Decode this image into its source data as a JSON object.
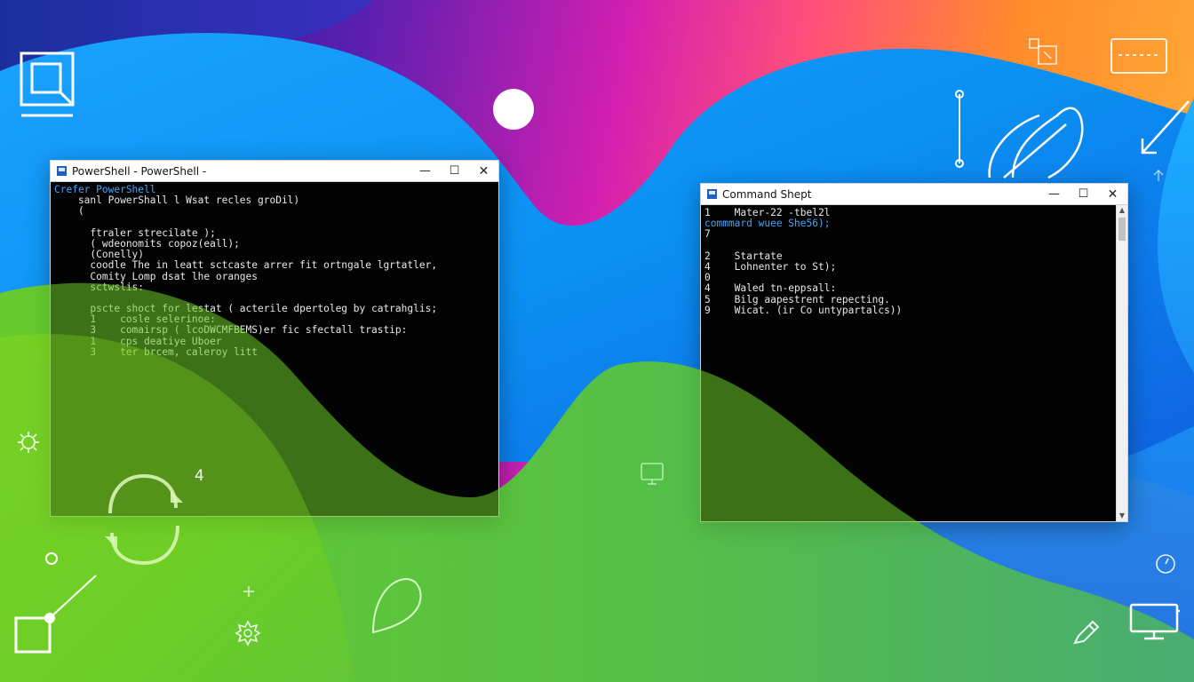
{
  "windows": {
    "powershell": {
      "title": "PowerShell - PowerShell -",
      "minimize_glyph": "—",
      "maximize_glyph": "☐",
      "close_glyph": "✕",
      "lines": [
        {
          "text": "Crefer PowerShell",
          "style": "blue"
        },
        {
          "text": "    sanl PowerShall l Wsat recles groDil)",
          "style": "normal"
        },
        {
          "text": "    (",
          "style": "normal"
        },
        {
          "text": "",
          "style": "normal"
        },
        {
          "text": "      ftraler strecilate );",
          "style": "normal"
        },
        {
          "text": "      ( wdeonomits copoz(eall);",
          "style": "normal"
        },
        {
          "text": "      (Conelly)",
          "style": "normal"
        },
        {
          "text": "      coodle The in leatt sctcaste arrer fit ortngale lgrtatler,",
          "style": "normal"
        },
        {
          "text": "      Comity Lomp dsat lhe oranges",
          "style": "normal"
        },
        {
          "text": "      sctwslis:",
          "style": "normal"
        },
        {
          "text": "",
          "style": "normal"
        },
        {
          "text": "      pscte shoct for lestat ( acterile dpertoleg by catrahglis;",
          "style": "normal"
        },
        {
          "text": "      1    cosle selerinoe:",
          "style": "normal"
        },
        {
          "text": "      3    comairsp ( lcoDWCMFBEMS)er fic sfectall trastip:",
          "style": "normal"
        },
        {
          "text": "      1    cps deatiye Uboer",
          "style": "normal"
        },
        {
          "text": "      3    ter brcem, caleroy litt",
          "style": "normal"
        }
      ]
    },
    "command": {
      "title": "Command Shept",
      "minimize_glyph": "—",
      "maximize_glyph": "☐",
      "close_glyph": "✕",
      "lines": [
        {
          "text": "1    Mater-22 -tbel2l",
          "style": "normal"
        },
        {
          "text": "commmard wuee She56);",
          "style": "blue"
        },
        {
          "text": "7",
          "style": "normal"
        },
        {
          "text": "",
          "style": "normal"
        },
        {
          "text": "2    Startate",
          "style": "normal"
        },
        {
          "text": "4    Lohnenter to St);",
          "style": "normal"
        },
        {
          "text": "0",
          "style": "normal"
        },
        {
          "text": "4    Waled tn-eppsall:",
          "style": "normal"
        },
        {
          "text": "5    Bilg aapestrent repecting.",
          "style": "normal"
        },
        {
          "text": "9    Wicat. (ir Co untypartalcs))",
          "style": "normal"
        }
      ]
    }
  },
  "decor": {
    "badge_number": "4"
  },
  "colors": {
    "accent_blue": "#3fa6ff",
    "terminal_bg": "#030303",
    "terminal_fg": "#e8e8e8",
    "titlebar_bg": "#ffffff"
  },
  "icons": {
    "top_left": "frame-icon",
    "top_right_a": "grid-icon",
    "top_right_b": "window-icon",
    "arrow": "arrow-icon",
    "bug": "bug-icon",
    "refresh": "refresh-cycle-icon",
    "monitor_small": "monitor-icon",
    "gear": "gear-icon",
    "pen": "pen-icon",
    "monitor_right": "display-icon",
    "clock": "clock-icon",
    "leaf": "leaf-icon"
  }
}
